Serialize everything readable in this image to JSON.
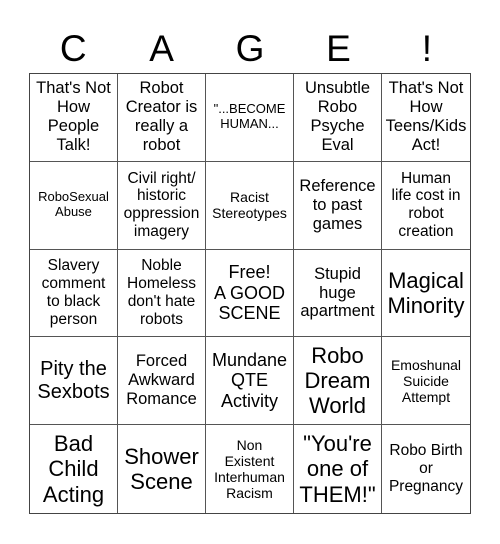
{
  "header": {
    "letters": [
      "C",
      "A",
      "G",
      "E",
      "!"
    ]
  },
  "cells": [
    [
      "That's Not\nHow\nPeople\nTalk!",
      "Robot\nCreator is\nreally a\nrobot",
      "\"...BECOME\nHUMAN...",
      "Unsubtle\nRobo\nPsyche\nEval",
      "That's Not\nHow\nTeens/Kids\nAct!"
    ],
    [
      "RoboSexual\nAbuse",
      "Civil right/\nhistoric\noppression\nimagery",
      "Racist\nStereotypes",
      "Reference\nto past\ngames",
      "Human\nlife cost in\nrobot\ncreation"
    ],
    [
      "Slavery\ncomment\nto black\nperson",
      "Noble\nHomeless\ndon't hate\nrobots",
      "Free!\nA GOOD\nSCENE",
      "Stupid\nhuge\napartment",
      "Magical\nMinority"
    ],
    [
      "Pity the\nSexbots",
      "Forced\nAwkward\nRomance",
      "Mundane\nQTE\nActivity",
      "Robo\nDream\nWorld",
      "Emoshunal\nSuicide\nAttempt"
    ],
    [
      "Bad\nChild\nActing",
      "Shower\nScene",
      "Non\nExistent\nInterhuman\nRacism",
      "\"You're\none of\nTHEM!\"",
      "Robo Birth\nor\nPregnancy"
    ]
  ]
}
